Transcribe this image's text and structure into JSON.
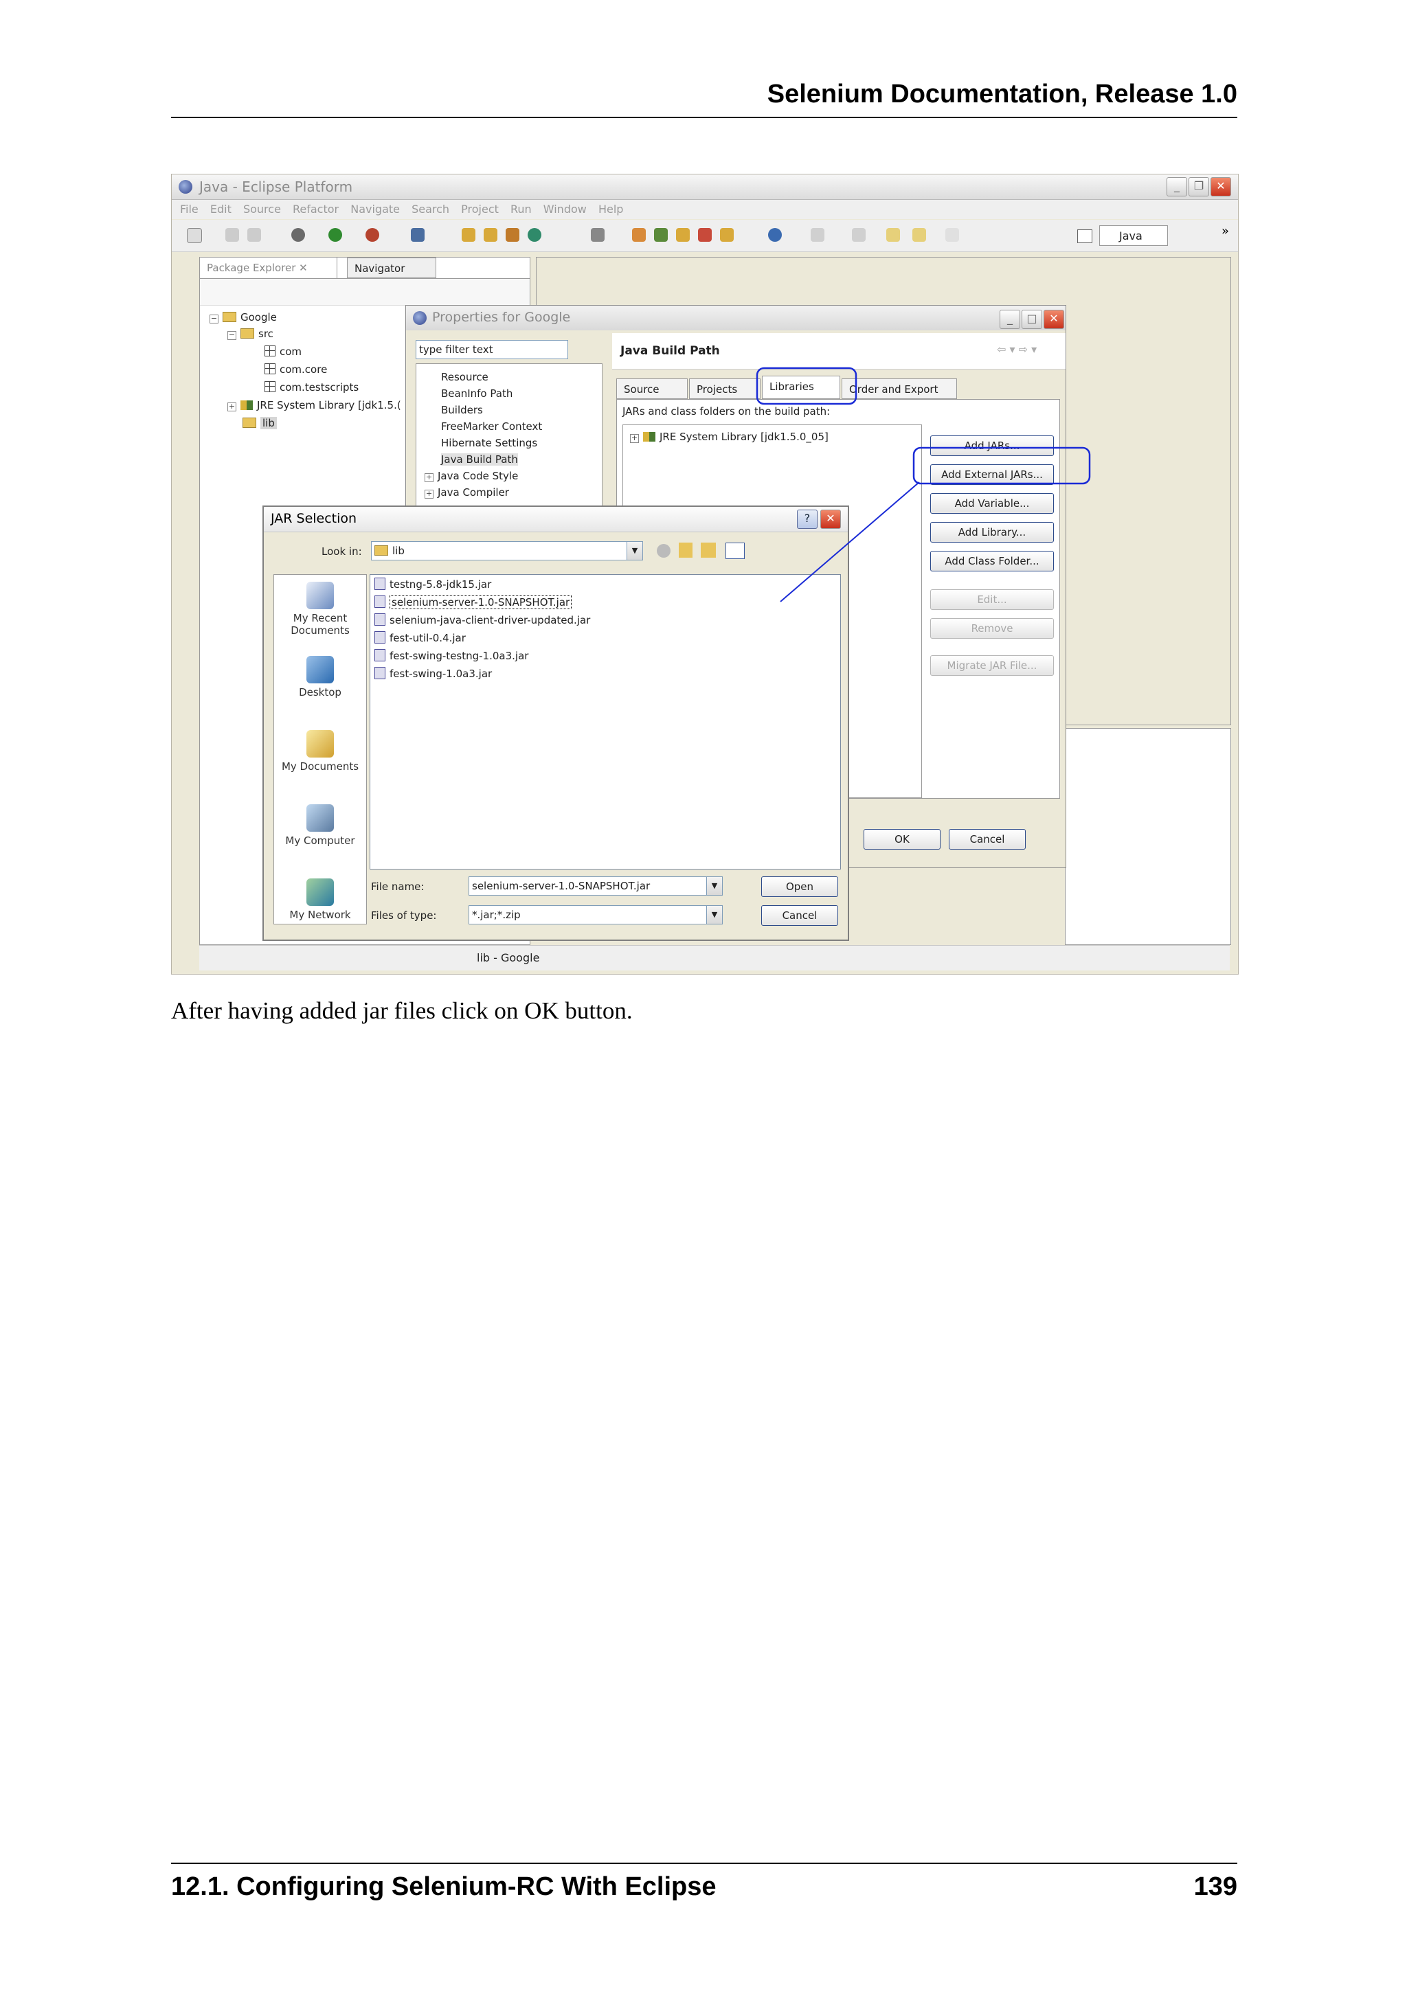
{
  "header": {
    "title": "Selenium Documentation, Release 1.0"
  },
  "footer": {
    "section": "12.1.  Configuring Selenium-RC With Eclipse",
    "page": "139"
  },
  "caption": "After having added jar files click on OK button.",
  "figure": {
    "window_title": "Java - Eclipse Platform",
    "menu": [
      "File",
      "Edit",
      "Source",
      "Refactor",
      "Navigate",
      "Search",
      "Project",
      "Run",
      "Window",
      "Help"
    ],
    "perspective": "Java",
    "views": {
      "package_explorer": "Package Explorer",
      "navigator": "Navigator"
    },
    "tree": {
      "project": "Google",
      "src": "src",
      "packages": [
        "com",
        "com.core",
        "com.testscripts"
      ],
      "jre": "JRE System Library [jdk1.5.(",
      "lib": "lib"
    },
    "status": "lib - Google",
    "properties": {
      "title": "Properties for Google",
      "filter_placeholder": "type filter text",
      "categories": [
        "Resource",
        "BeanInfo Path",
        "Builders",
        "FreeMarker Context",
        "Hibernate Settings",
        "Java Build Path",
        "Java Code Style",
        "Java Compiler"
      ],
      "page_title": "Java Build Path",
      "tabs": [
        "Source",
        "Projects",
        "Libraries",
        "Order and Export"
      ],
      "path_label": "JARs and class folders on the build path:",
      "entry": "JRE System Library [jdk1.5.0_05]",
      "buttons": [
        "Add JARs...",
        "Add External JARs...",
        "Add Variable...",
        "Add Library...",
        "Add Class Folder...",
        "Edit...",
        "Remove",
        "Migrate JAR File..."
      ],
      "ok": "OK",
      "cancel": "Cancel"
    },
    "jar_dialog": {
      "title": "JAR Selection",
      "help": "?",
      "look_in_label": "Look in:",
      "look_in_value": "lib",
      "places": [
        "My Recent Documents",
        "Desktop",
        "My Documents",
        "My Computer",
        "My Network"
      ],
      "files": [
        "testng-5.8-jdk15.jar",
        "selenium-server-1.0-SNAPSHOT.jar",
        "selenium-java-client-driver-updated.jar",
        "fest-util-0.4.jar",
        "fest-swing-testng-1.0a3.jar",
        "fest-swing-1.0a3.jar"
      ],
      "file_name_label": "File name:",
      "file_name_value": "selenium-server-1.0-SNAPSHOT.jar",
      "file_type_label": "Files of type:",
      "file_type_value": "*.jar;*.zip",
      "open": "Open",
      "cancel": "Cancel"
    },
    "annotation_color": "#1a2bd6"
  }
}
